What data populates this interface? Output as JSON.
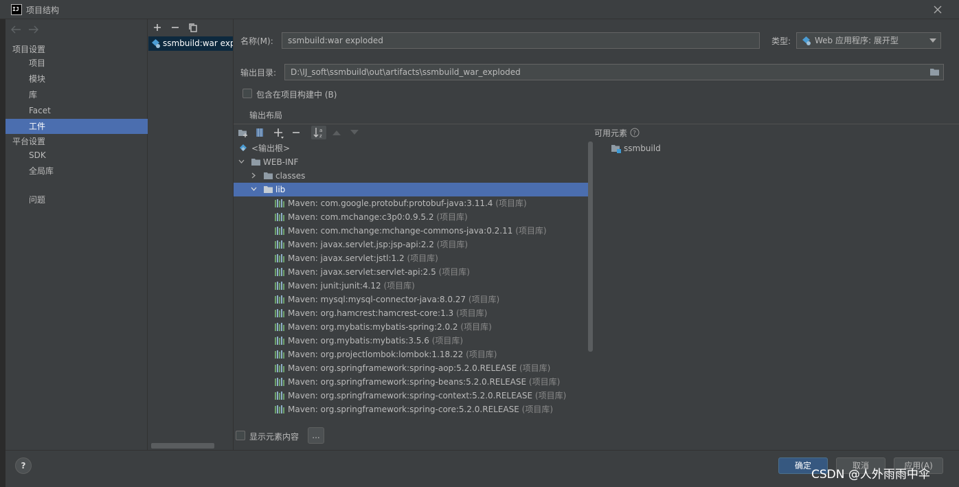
{
  "window": {
    "title": "项目结构",
    "app_icon_text": "IJ"
  },
  "sidebar": {
    "project_settings_title": "项目设置",
    "project_settings_items": [
      "项目",
      "模块",
      "库",
      "Facet",
      "工件"
    ],
    "platform_settings_title": "平台设置",
    "platform_settings_items": [
      "SDK",
      "全局库"
    ],
    "problems": "问题",
    "selected": "工件"
  },
  "artifacts": {
    "selected_name": "ssmbuild:war exploded"
  },
  "form": {
    "name_label": "名称(M):",
    "name_value": "ssmbuild:war exploded",
    "type_label": "类型:",
    "type_value": "Web 应用程序: 展开型",
    "output_dir_label": "输出目录:",
    "output_dir_value": "D:\\IJ_soft\\ssmbuild\\out\\artifacts\\ssmbuild_war_exploded",
    "include_in_build_label": "包含在项目构建中 (B)",
    "include_in_build_checked": false
  },
  "output_layout": {
    "tab_label": "输出布局",
    "available_elements_label": "可用元素",
    "available_elements": [
      {
        "name": "ssmbuild",
        "icon": "module-folder-icon"
      }
    ],
    "tree": {
      "root": "<输出根>",
      "web_inf": "WEB-INF",
      "classes": "classes",
      "lib": "lib",
      "libraries": [
        {
          "name": "Maven: com.google.protobuf:protobuf-java:3.11.4",
          "tag": "(项目库)"
        },
        {
          "name": "Maven: com.mchange:c3p0:0.9.5.2",
          "tag": "(项目库)"
        },
        {
          "name": "Maven: com.mchange:mchange-commons-java:0.2.11",
          "tag": "(项目库)"
        },
        {
          "name": "Maven: javax.servlet.jsp:jsp-api:2.2",
          "tag": "(项目库)"
        },
        {
          "name": "Maven: javax.servlet:jstl:1.2",
          "tag": "(项目库)"
        },
        {
          "name": "Maven: javax.servlet:servlet-api:2.5",
          "tag": "(项目库)"
        },
        {
          "name": "Maven: junit:junit:4.12",
          "tag": "(项目库)"
        },
        {
          "name": "Maven: mysql:mysql-connector-java:8.0.27",
          "tag": "(项目库)"
        },
        {
          "name": "Maven: org.hamcrest:hamcrest-core:1.3",
          "tag": "(项目库)"
        },
        {
          "name": "Maven: org.mybatis:mybatis-spring:2.0.2",
          "tag": "(项目库)"
        },
        {
          "name": "Maven: org.mybatis:mybatis:3.5.6",
          "tag": "(项目库)"
        },
        {
          "name": "Maven: org.projectlombok:lombok:1.18.22",
          "tag": "(项目库)"
        },
        {
          "name": "Maven: org.springframework:spring-aop:5.2.0.RELEASE",
          "tag": "(项目库)"
        },
        {
          "name": "Maven: org.springframework:spring-beans:5.2.0.RELEASE",
          "tag": "(项目库)"
        },
        {
          "name": "Maven: org.springframework:spring-context:5.2.0.RELEASE",
          "tag": "(项目库)"
        },
        {
          "name": "Maven: org.springframework:spring-core:5.2.0.RELEASE",
          "tag": "(项目库)"
        }
      ]
    },
    "show_content_label": "显示元素内容",
    "show_content_checked": false,
    "ellipsis_label": "..."
  },
  "footer": {
    "help": "?",
    "ok": "确定",
    "cancel": "取消",
    "apply": "应用(A)"
  },
  "watermark": "CSDN @人外雨雨中伞",
  "colors": {
    "background": "#3c3f41",
    "selection": "#4b6eaf",
    "primary_button": "#365880",
    "text": "#bbbbbb"
  }
}
